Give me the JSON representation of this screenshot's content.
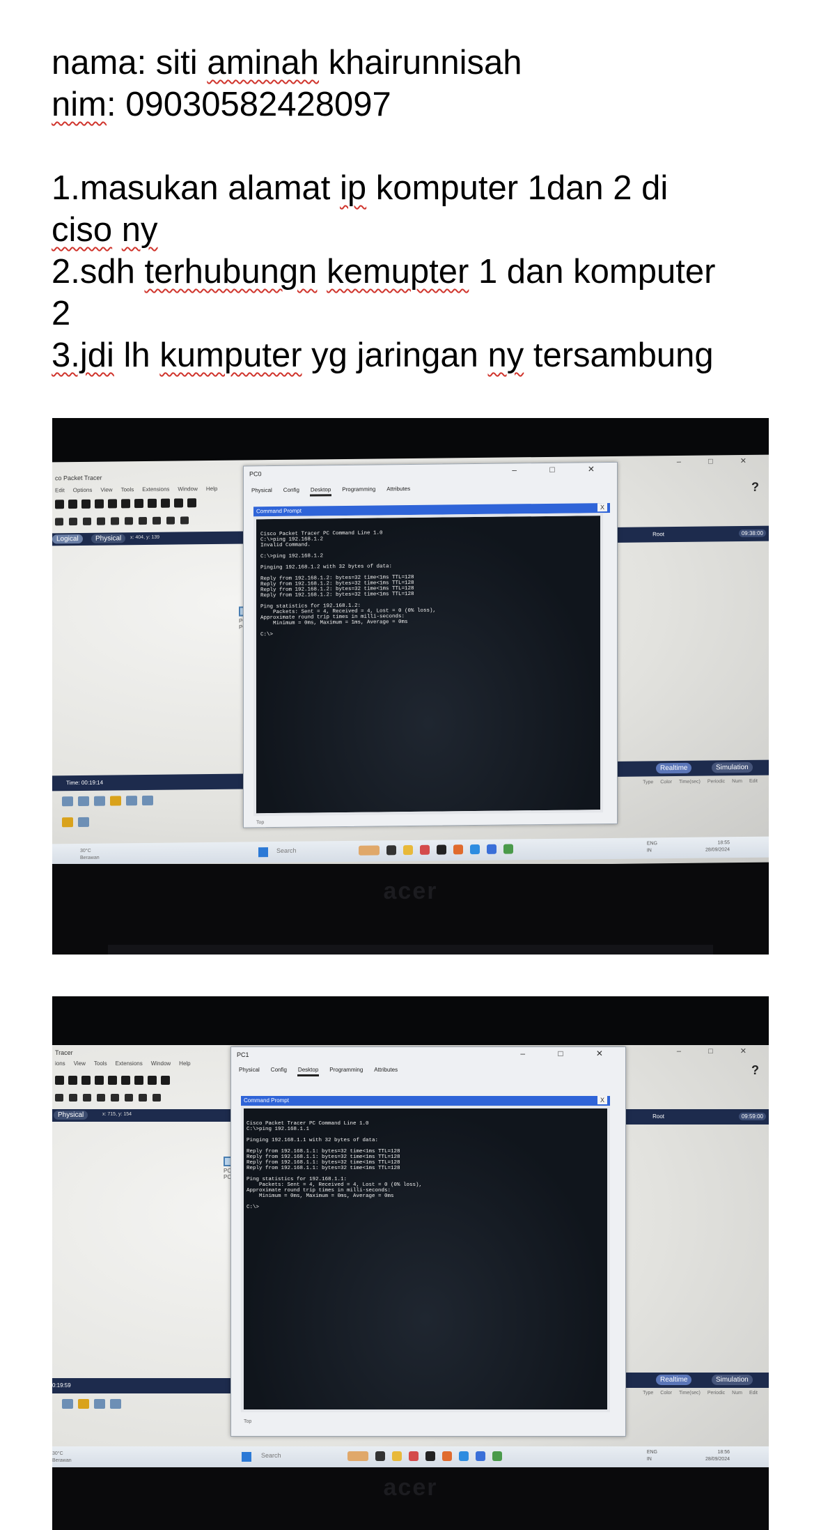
{
  "document": {
    "lines": [
      "nama: siti aminah khairunnisah",
      "nim: 09030582428097",
      "",
      "1.masukan alamat ip komputer 1dan 2 di",
      "ciso ny",
      "2.sdh terhubungn kemupter 1 dan komputer",
      "2",
      "3.jdi lh kumputer yg jaringan ny tersambung"
    ],
    "spellcheck_words": [
      "aminah",
      "nim",
      "ip",
      "ciso",
      "ny",
      "terhubungn",
      "kemupter",
      "3.jdi",
      "kumputer",
      "ny"
    ]
  },
  "photo1": {
    "app_title": "co Packet Tracer",
    "menu": [
      "Edit",
      "Options",
      "View",
      "Tools",
      "Extensions",
      "Window",
      "Help"
    ],
    "tab_logical": "Logical",
    "tab_physical": "Physical",
    "coords": "x: 404, y: 139",
    "root_label": "Root",
    "clock": "09:38:00",
    "time_label": "Time: 00:19:14",
    "realtime": "Realtime",
    "simulation": "Simulation",
    "columns": [
      "Type",
      "Color",
      "Time(sec)",
      "Periodic",
      "Num",
      "Edit"
    ],
    "pc_label": "PC-\nPC",
    "window": {
      "title": "PC0",
      "tabs": [
        "Physical",
        "Config",
        "Desktop",
        "Programming",
        "Attributes"
      ],
      "active_tab": "Desktop",
      "cmd_title": "Command Prompt",
      "close": "X",
      "top_label": "Top",
      "terminal": [
        "Cisco Packet Tracer PC Command Line 1.0",
        "C:\\>ping 192.168.1.2",
        "Invalid Command.",
        "",
        "C:\\>ping 192.168.1.2",
        "",
        "Pinging 192.168.1.2 with 32 bytes of data:",
        "",
        "Reply from 192.168.1.2: bytes=32 time<1ms TTL=128",
        "Reply from 192.168.1.2: bytes=32 time<1ms TTL=128",
        "Reply from 192.168.1.2: bytes=32 time<1ms TTL=128",
        "Reply from 192.168.1.2: bytes=32 time<1ms TTL=128",
        "",
        "Ping statistics for 192.168.1.2:",
        "    Packets: Sent = 4, Received = 4, Lost = 0 (0% loss),",
        "Approximate round trip times in milli-seconds:",
        "    Minimum = 0ms, Maximum = 1ms, Average = 0ms",
        "",
        "C:\\>"
      ]
    },
    "taskbar": {
      "weather_temp": "30°C",
      "weather_desc": "Berawan",
      "search": "Search",
      "lang": "ENG\nIN",
      "time": "18:55",
      "date": "28/09/2024"
    },
    "brand": "acer"
  },
  "photo2": {
    "app_title": "Tracer",
    "menu": [
      "ions",
      "View",
      "Tools",
      "Extensions",
      "Window",
      "Help"
    ],
    "tab_physical": "Physical",
    "coords": "x: 715, y: 154",
    "root_label": "Root",
    "clock": "09:59:00",
    "time_label": "0:19:59",
    "realtime": "Realtime",
    "simulation": "Simulation",
    "columns": [
      "Type",
      "Color",
      "Time(sec)",
      "Periodic",
      "Num",
      "Edit"
    ],
    "pc_label": "PC-\nPC",
    "window": {
      "title": "PC1",
      "tabs": [
        "Physical",
        "Config",
        "Desktop",
        "Programming",
        "Attributes"
      ],
      "active_tab": "Desktop",
      "cmd_title": "Command Prompt",
      "close": "X",
      "top_label": "Top",
      "terminal": [
        "Cisco Packet Tracer PC Command Line 1.0",
        "C:\\>ping 192.168.1.1",
        "",
        "Pinging 192.168.1.1 with 32 bytes of data:",
        "",
        "Reply from 192.168.1.1: bytes=32 time<1ms TTL=128",
        "Reply from 192.168.1.1: bytes=32 time<1ms TTL=128",
        "Reply from 192.168.1.1: bytes=32 time<1ms TTL=128",
        "Reply from 192.168.1.1: bytes=32 time<1ms TTL=128",
        "",
        "Ping statistics for 192.168.1.1:",
        "    Packets: Sent = 4, Received = 4, Lost = 0 (0% loss),",
        "Approximate round trip times in milli-seconds:",
        "    Minimum = 0ms, Maximum = 0ms, Average = 0ms",
        "",
        "C:\\>"
      ]
    },
    "taskbar": {
      "weather_temp": "30°C",
      "weather_desc": "Berawan",
      "search": "Search",
      "lang": "ENG\nIN",
      "time": "18:56",
      "date": "28/09/2024"
    },
    "brand": "acer"
  },
  "colors": {
    "spellcheck_underline": "#d0342c",
    "packet_tracer_bar": "#1d2b4d",
    "cmd_title_bar": "#2f64d8",
    "terminal_bg": "#10151c"
  }
}
